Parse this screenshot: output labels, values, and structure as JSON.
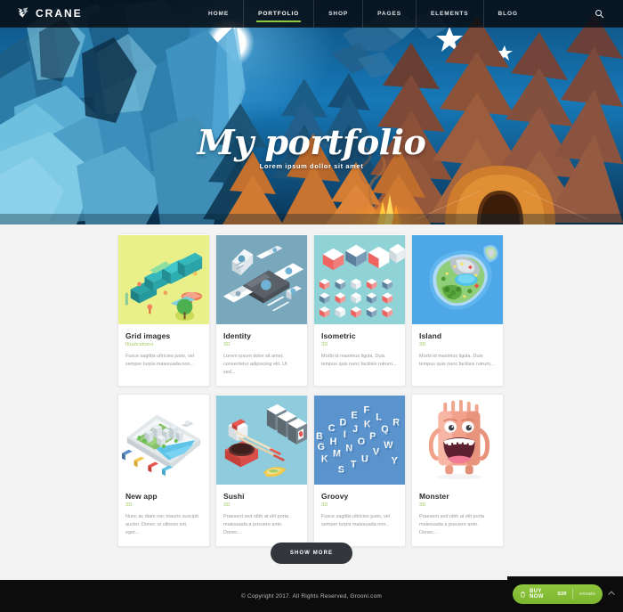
{
  "header": {
    "logo_text": "CRANE",
    "logo_icon": "crane-bird-icon",
    "search_icon": "search-icon",
    "nav": [
      {
        "label": "HOME",
        "active": false
      },
      {
        "label": "PORTFOLIO",
        "active": true
      },
      {
        "label": "SHOP",
        "active": false
      },
      {
        "label": "PAGES",
        "active": false
      },
      {
        "label": "ELEMENTS",
        "active": false
      },
      {
        "label": "BLOG",
        "active": false
      }
    ]
  },
  "hero": {
    "title": "My portfolio",
    "subtitle": "Lorem ipsum dollor sit amet",
    "scene": "low-poly night camping landscape with moon, stars, blue glacier mountains, orange pine trees, tent and campfire"
  },
  "portfolio": {
    "items": [
      {
        "title": "Grid images",
        "category": "Illustrations",
        "description": "Fusce sagittis ultricies justo, vel semper turpis malesuada non...",
        "thumb": "isometric-sun-letters",
        "thumb_bg": "#e9f08a"
      },
      {
        "title": "Identity",
        "category": "3D",
        "description": "Lorem ipsum dolor sit amet, consectetur adipiscing elit. Ut sed...",
        "thumb": "isometric-stationery-mockup",
        "thumb_bg": "#79a8bd"
      },
      {
        "title": "Isometric",
        "category": "3D",
        "description": "Morbi id maximus ligula. Duis tempus quis nunc facilisis rutrum...",
        "thumb": "isometric-red-white-cubes",
        "thumb_bg": "#8fd3d6"
      },
      {
        "title": "Island",
        "category": "3D",
        "description": "Morbi id maximus ligula. Duis tempus quis nunc facilisis rutrum...",
        "thumb": "isometric-island-map",
        "thumb_bg": "#4ea8e8"
      },
      {
        "title": "New app",
        "category": "3D",
        "description": "Nunc ac diam nec mauris suscipit auctor. Donec ut ultrices est, eget...",
        "thumb": "isometric-city-on-phone",
        "thumb_bg": "#ffffff"
      },
      {
        "title": "Sushi",
        "category": "3D",
        "description": "Praesent sed nibh at elit porta malesuada a posuere ante. Donec...",
        "thumb": "isometric-sushi-set",
        "thumb_bg": "#8ecbdc"
      },
      {
        "title": "Groovy",
        "category": "3D",
        "description": "Fusce sagittis ultricies justo, vel semper turpis malesuada non...",
        "thumb": "isometric-3d-alphabet",
        "thumb_bg": "#5b93cc"
      },
      {
        "title": "Monster",
        "category": "3D",
        "description": "Praesent sed nibh at elit porta malesuada a posuere ante. Donec...",
        "thumb": "pink-monster-character",
        "thumb_bg": "#ffffff"
      }
    ],
    "show_more_label": "SHOW MORE"
  },
  "footer": {
    "copyright": "© Copyright 2017. All Rights Reserved, Grooni.com"
  },
  "buy_bar": {
    "cart_icon": "cart-icon",
    "label": "BUY NOW",
    "price": "$39",
    "marketplace": "envato",
    "chevron_icon": "chevron-up-icon"
  },
  "colors": {
    "accent_green": "#8dc63f",
    "header_bg": "#080e16",
    "footer_bg": "#0c0c0c",
    "page_bg": "#f3f3f3",
    "card_bg": "#ffffff",
    "category_text": "#9ec95a"
  }
}
